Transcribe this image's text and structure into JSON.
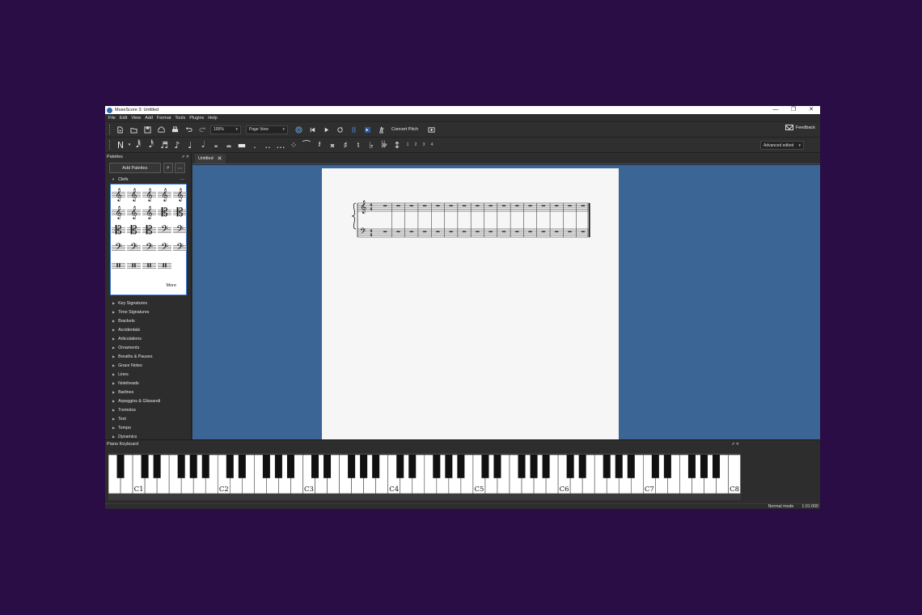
{
  "window": {
    "title": "MuseScore 3: Untitled",
    "controls": [
      "—",
      "❐",
      "✕"
    ]
  },
  "menu": [
    "File",
    "Edit",
    "View",
    "Add",
    "Format",
    "Tools",
    "Plugins",
    "Help"
  ],
  "toolbar": {
    "zoom": "100%",
    "view_mode": "Page View",
    "concert_pitch": "Concert Pitch",
    "feedback": "Feedback"
  },
  "note_toolbar": {
    "voices": [
      "1",
      "2",
      "3",
      "4"
    ],
    "workspace": "Advanced edited"
  },
  "palettes": {
    "panel_title": "Palettes",
    "add_button": "Add Palettes",
    "open_section": "Clefs",
    "more": "More",
    "items": [
      "Key Signatures",
      "Time Signatures",
      "Brackets",
      "Accidentals",
      "Articulations",
      "Ornaments",
      "Breaths & Pauses",
      "Grace Notes",
      "Lines",
      "Noteheads",
      "Barlines",
      "Arpeggios & Glissandi",
      "Tremolos",
      "Text",
      "Tempo",
      "Dynamics"
    ]
  },
  "score": {
    "tab_label": "Untitled",
    "measures": 16
  },
  "piano": {
    "panel_title": "Piano Keyboard",
    "labels": [
      "C1",
      "C2",
      "C3",
      "C4",
      "C5",
      "C6",
      "C7",
      "C8"
    ]
  },
  "status": {
    "mode": "Normal mode",
    "position": "1:01:000"
  },
  "colors": {
    "background": "#2a0d45",
    "canvas": "#3a6594",
    "accent": "#3a7ad9"
  }
}
